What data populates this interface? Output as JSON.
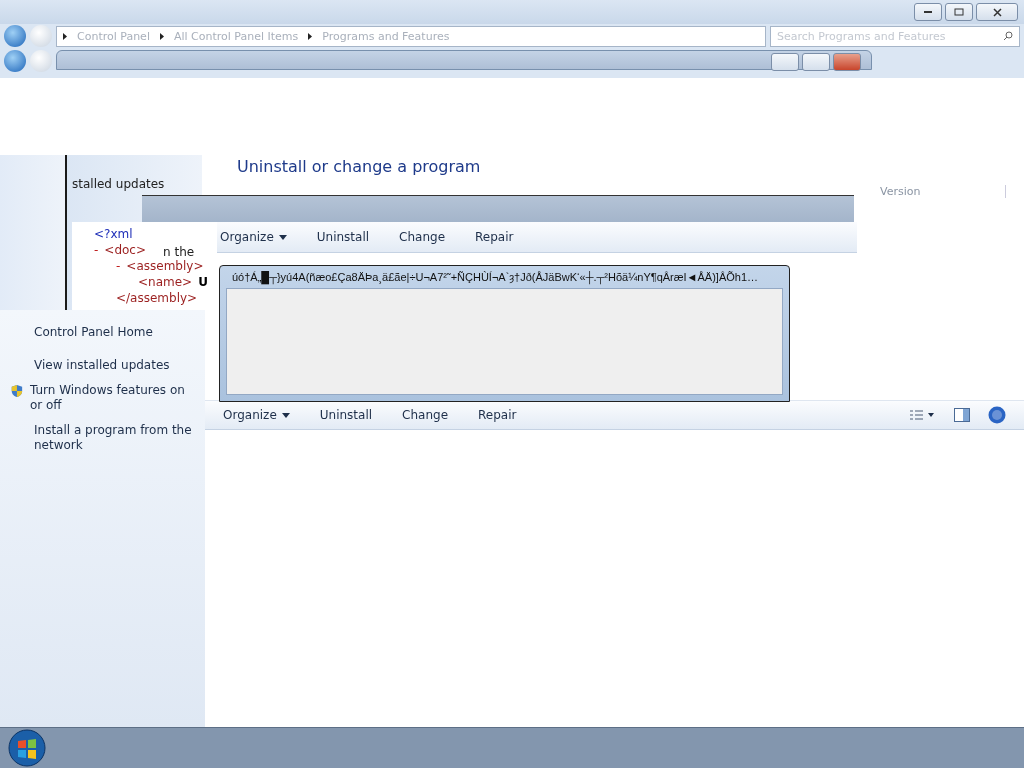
{
  "address_bar": {
    "breadcrumbs": [
      "Control Panel",
      "All Control Panel Items",
      "Programs and Features"
    ],
    "search_placeholder": "Search Programs and Features"
  },
  "ghost_window": {
    "heading": "Uninstall or change a program",
    "nav_fragment": "stalled updates",
    "text_fragment": "n the",
    "xml": [
      {
        "tag": "<?xml"
      },
      {
        "toggle": "-",
        "tag": "<doc>",
        "children": [
          {
            "toggle": "-",
            "tag": "<assembly>",
            "close": "</assembly>",
            "children": [
              {
                "tag": "<name>",
                "value": "U"
              }
            ]
          }
        ]
      }
    ],
    "toolbar": {
      "organize": "Organize",
      "buttons": [
        "Uninstall",
        "Change",
        "Repair"
      ]
    },
    "column": "Version"
  },
  "sidebar": {
    "items": [
      {
        "label": "Control Panel Home",
        "kind": "link"
      },
      {
        "label": "View installed updates",
        "kind": "link"
      },
      {
        "label": "Turn Windows features on or off",
        "kind": "shield"
      },
      {
        "label": "Install a program from the network",
        "kind": "link"
      }
    ]
  },
  "toolbar": {
    "organize": "Organize",
    "buttons": [
      "Uninstall",
      "Change",
      "Repair"
    ]
  },
  "dialog": {
    "title": "úó†Á„█┬}yú4A(ñæo£Ça8ÄÞa¸ä£ãe|÷U¬A7²˜+ÑÇHÙÍ¬A`ȝ†Jð(ÅJäBwK‘«┼.┬²Hõä¼nY¶qÂræI◄ÅÄ)]ÂÕh1…"
  }
}
